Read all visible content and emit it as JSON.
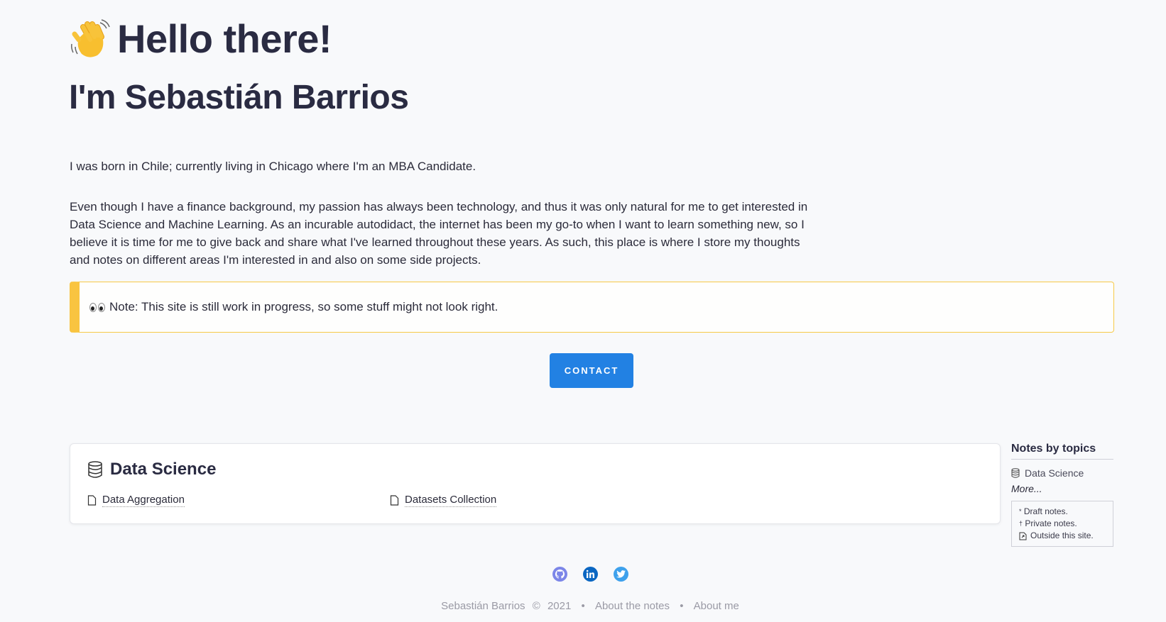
{
  "hero": {
    "greeting": "Hello there!",
    "name": "I'm Sebastián Barrios",
    "bio_line1": "I was born in Chile; currently living in Chicago where I'm an MBA Candidate.",
    "bio_paragraph": "Even though I have a finance background, my passion has always been technology, and thus it was only natural for me to get interested in Data Science and Machine Learning. As an incurable autodidact, the internet has been my go-to when I want to learn something new, so I believe it is time for me to give back and share what I've learned throughout these years. As such, this place is where I store my thoughts and notes on different areas I'm interested in and also on some side projects."
  },
  "note": {
    "text": "Note: This site is still work in progress, so some stuff might not look right."
  },
  "contact": {
    "label": "CONTACT"
  },
  "topic_card": {
    "title": "Data Science",
    "links": [
      {
        "label": "Data Aggregation"
      },
      {
        "label": "Datasets Collection"
      }
    ]
  },
  "sidebar": {
    "title": "Notes by topics",
    "item": "Data Science",
    "more": "More...",
    "legend": {
      "draft_mark": "*",
      "draft": "Draft notes.",
      "private_mark": "†",
      "private": "Private notes.",
      "outside": "Outside this site."
    }
  },
  "social": {
    "icons": [
      "github-icon",
      "linkedin-icon",
      "twitter-icon"
    ],
    "colors": {
      "github": "#7c86e8",
      "linkedin": "#0a66c2",
      "twitter": "#3ea1ec"
    }
  },
  "footer": {
    "author": "Sebastián Barrios",
    "copyright": "©",
    "year": "2021",
    "sep1": "•",
    "about_notes": "About the notes",
    "sep2": "•",
    "about_me": "About me"
  },
  "colors": {
    "accent": "#2281e3",
    "note_border": "#f9c440",
    "background": "#f8f9fb"
  }
}
